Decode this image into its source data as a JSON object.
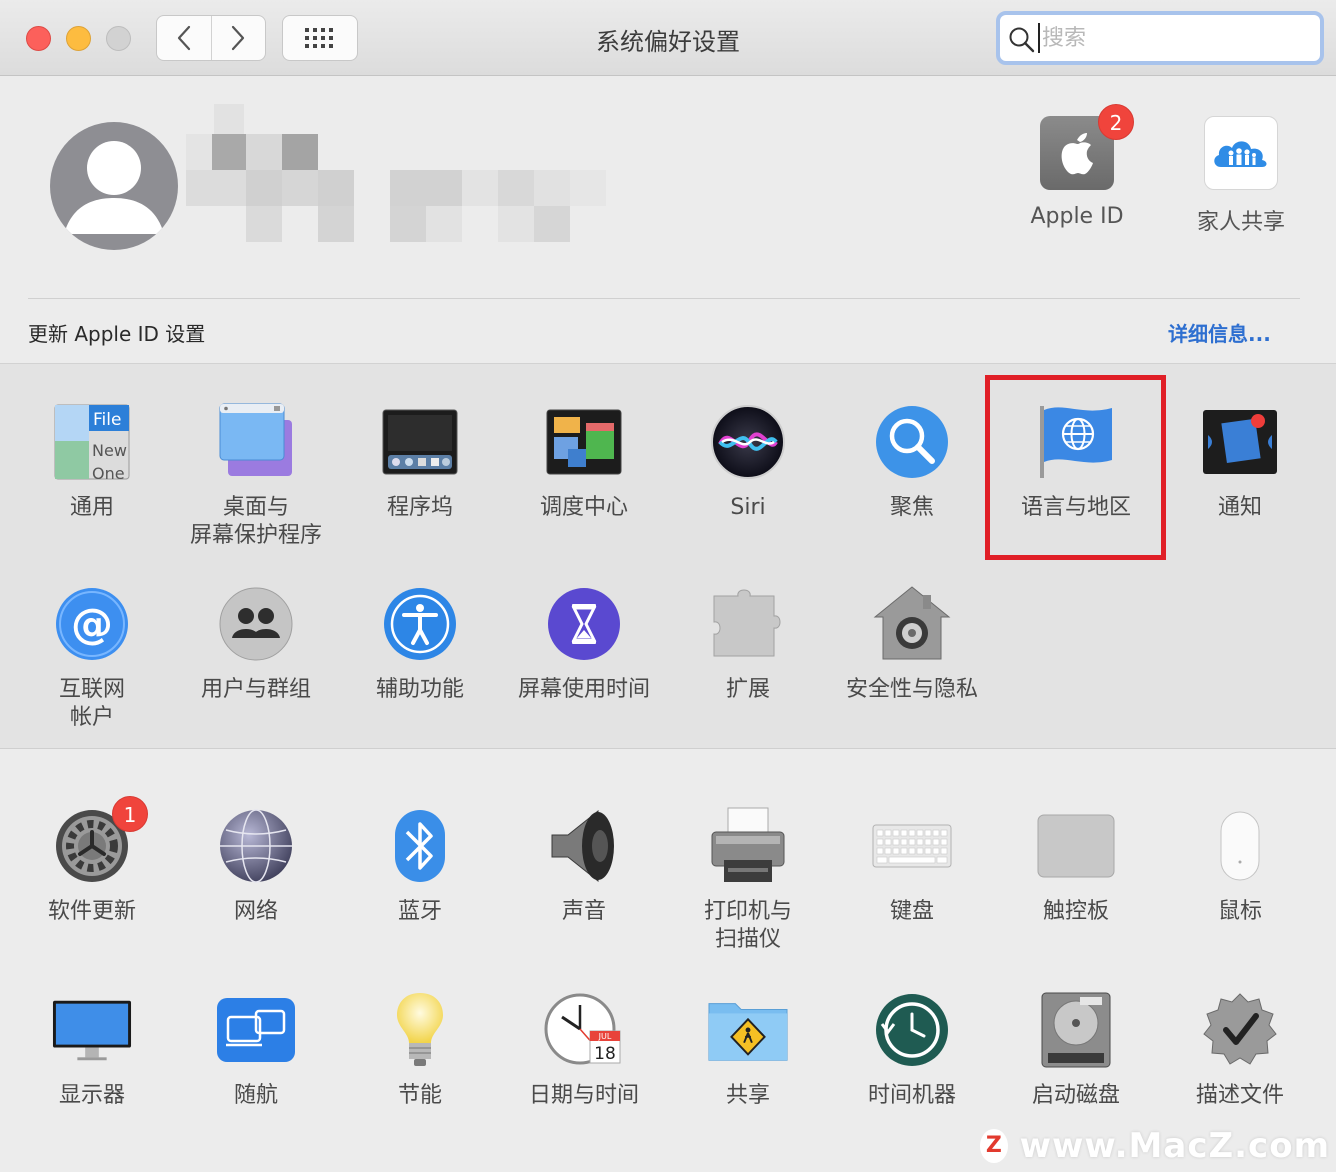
{
  "window": {
    "title": "系统偏好设置",
    "search_placeholder": "搜索"
  },
  "account": {
    "apple_id_label": "Apple ID",
    "apple_id_badge": "2",
    "family_label": "家人共享",
    "update_text": "更新 Apple ID 设置",
    "details_link": "详细信息..."
  },
  "section1": [
    {
      "id": "general",
      "label": "通用",
      "icon": "general-icon"
    },
    {
      "id": "desktop",
      "label": "桌面与\n屏幕保护程序",
      "icon": "desktop-icon"
    },
    {
      "id": "dock",
      "label": "程序坞",
      "icon": "dock-icon"
    },
    {
      "id": "mission",
      "label": "调度中心",
      "icon": "mission-control-icon"
    },
    {
      "id": "siri",
      "label": "Siri",
      "icon": "siri-icon"
    },
    {
      "id": "spotlight",
      "label": "聚焦",
      "icon": "spotlight-icon"
    },
    {
      "id": "language",
      "label": "语言与地区",
      "icon": "flag-globe-icon"
    },
    {
      "id": "notifications",
      "label": "通知",
      "icon": "notifications-icon"
    }
  ],
  "section1_row2": [
    {
      "id": "internet",
      "label": "互联网\n帐户",
      "icon": "at-sign-icon"
    },
    {
      "id": "users",
      "label": "用户与群组",
      "icon": "users-icon"
    },
    {
      "id": "accessibility",
      "label": "辅助功能",
      "icon": "accessibility-icon"
    },
    {
      "id": "screentime",
      "label": "屏幕使用时间",
      "icon": "hourglass-icon"
    },
    {
      "id": "extensions",
      "label": "扩展",
      "icon": "puzzle-icon"
    },
    {
      "id": "security",
      "label": "安全性与隐私",
      "icon": "house-lock-icon"
    }
  ],
  "section2": [
    {
      "id": "software-update",
      "label": "软件更新",
      "icon": "gear-icon",
      "badge": "1"
    },
    {
      "id": "network",
      "label": "网络",
      "icon": "globe-icon"
    },
    {
      "id": "bluetooth",
      "label": "蓝牙",
      "icon": "bluetooth-icon"
    },
    {
      "id": "sound",
      "label": "声音",
      "icon": "speaker-icon"
    },
    {
      "id": "printers",
      "label": "打印机与\n扫描仪",
      "icon": "printer-icon"
    },
    {
      "id": "keyboard",
      "label": "键盘",
      "icon": "keyboard-icon"
    },
    {
      "id": "trackpad",
      "label": "触控板",
      "icon": "trackpad-icon"
    },
    {
      "id": "mouse",
      "label": "鼠标",
      "icon": "mouse-icon"
    }
  ],
  "section2_row2": [
    {
      "id": "displays",
      "label": "显示器",
      "icon": "display-icon"
    },
    {
      "id": "sidecar",
      "label": "随航",
      "icon": "sidecar-icon"
    },
    {
      "id": "energy",
      "label": "节能",
      "icon": "lightbulb-icon"
    },
    {
      "id": "datetime",
      "label": "日期与时间",
      "icon": "clock-calendar-icon"
    },
    {
      "id": "sharing",
      "label": "共享",
      "icon": "sharing-folder-icon"
    },
    {
      "id": "timemachine",
      "label": "时间机器",
      "icon": "time-machine-icon"
    },
    {
      "id": "startup",
      "label": "启动磁盘",
      "icon": "hard-disk-icon"
    },
    {
      "id": "profiles",
      "label": "描述文件",
      "icon": "checkmark-badge-icon"
    }
  ],
  "icon_text": {
    "general_file": "File",
    "general_new": "New",
    "general_one": "One",
    "calendar_month": "JUL",
    "calendar_day": "18"
  },
  "watermark": {
    "logo": "Z",
    "text": "www.MacZ.com"
  },
  "colors": {
    "highlight": "#e01f27",
    "link": "#2e6fd0",
    "badge": "#f0443c"
  }
}
